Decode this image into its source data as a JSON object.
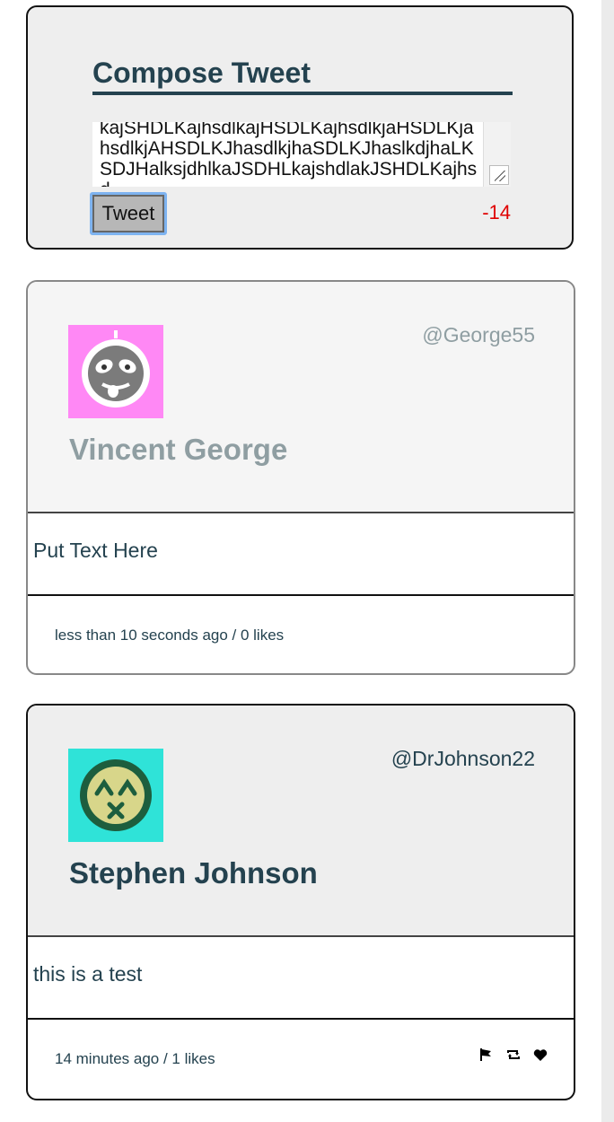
{
  "compose": {
    "title": "Compose Tweet",
    "textarea_value": "kajSHDLKajhsdlkajHSDLKajhsdlkjaHSDLKjahsdlkjAHSDLKJhasdlkjhaSDLKJhaslkdjhaLKSDJHalksjdhlkaJSDHLkajshdlakJSHDLKajhsd",
    "tweet_button": "Tweet",
    "char_counter": "-14",
    "counter_color": "#e00000"
  },
  "tweets": [
    {
      "handle": "@George55",
      "name": "Vincent George",
      "text": "Put Text Here",
      "meta": "less than 10 seconds ago / 0 likes",
      "avatar": {
        "bg": "#ff88f5",
        "face": "#7b7b7b",
        "icon": "silly-face-avatar-icon"
      }
    },
    {
      "handle": "@DrJohnson22",
      "name": "Stephen Johnson",
      "text": "this is a test",
      "meta": "14 minutes ago / 1 likes",
      "avatar": {
        "bg": "#2fe3d8",
        "face": "#1d5e3e",
        "icon": "dizzy-face-avatar-icon"
      },
      "actions": [
        "flag-icon",
        "retweet-icon",
        "heart-icon"
      ]
    }
  ],
  "colors": {
    "accent": "#24424f",
    "muted": "#8f9ea2"
  }
}
